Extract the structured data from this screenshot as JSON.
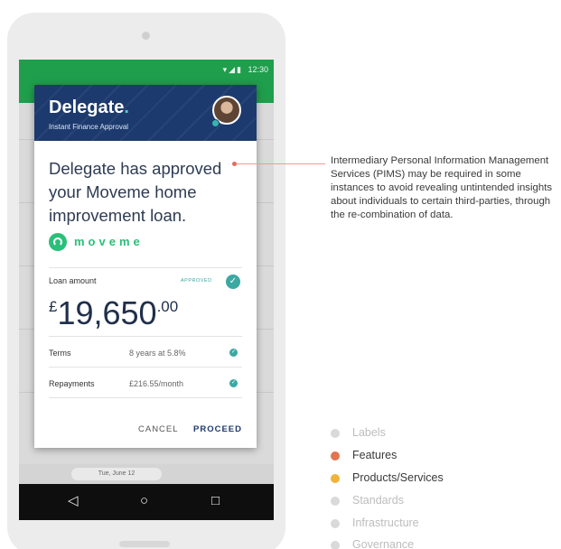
{
  "phone": {
    "status": {
      "icons": "▾◢▮",
      "time": "12:30"
    },
    "date_pill": "Tue, June 12",
    "nav": {
      "back": "◁",
      "home": "○",
      "recents": "□"
    }
  },
  "dialog": {
    "brand": "Delegate",
    "brand_dot": ".",
    "subtitle": "Instant Finance Approval",
    "message": "Delegate has approved your Moveme home improvement loan.",
    "partner": "moveme",
    "loan_label": "Loan amount",
    "status_badge": "APPROVED",
    "currency": "£",
    "amount_main": "19,650",
    "amount_decimal": ".00",
    "rows": [
      {
        "label": "Terms",
        "value": "8 years at 5.8%"
      },
      {
        "label": "Repayments",
        "value": "£216.55/month"
      }
    ],
    "cancel_label": "CANCEL",
    "proceed_label": "PROCEED"
  },
  "annotation": "Intermediary Personal Information Management Services (PIMS) may be required in some instances to avoid revealing untintended insights about individuals to certain third-parties, through the re-combination of data.",
  "legend": [
    {
      "label": "Labels",
      "color": "#d9d9d9",
      "text_color": "#bdbdbd"
    },
    {
      "label": "Features",
      "color": "#e2744f",
      "text_color": "#3a3a3a"
    },
    {
      "label": "Products/Services",
      "color": "#f0b43a",
      "text_color": "#3a3a3a"
    },
    {
      "label": "Standards",
      "color": "#d9d9d9",
      "text_color": "#bdbdbd"
    },
    {
      "label": "Infrastructure",
      "color": "#d9d9d9",
      "text_color": "#bdbdbd"
    },
    {
      "label": "Governance",
      "color": "#d9d9d9",
      "text_color": "#bdbdbd"
    }
  ],
  "colors": {
    "header": "#1d3a6e",
    "accent": "#3aa9a2",
    "status_bar": "#1f9e4c",
    "moveme": "#2bbf7a"
  }
}
